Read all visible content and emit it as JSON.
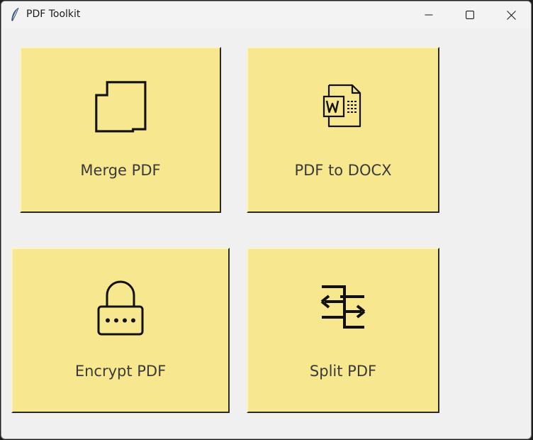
{
  "window": {
    "title": "PDF Toolkit",
    "controls": {
      "minimize": "minimize",
      "maximize": "maximize",
      "close": "close"
    }
  },
  "tiles": [
    {
      "label": "Merge PDF",
      "icon": "merge-icon"
    },
    {
      "label": "PDF to DOCX",
      "icon": "word-document-icon"
    },
    {
      "label": "Encrypt PDF",
      "icon": "lock-icon"
    },
    {
      "label": "Split PDF",
      "icon": "split-arrows-icon"
    }
  ],
  "colors": {
    "tile_background": "#f7e78f",
    "window_background": "#f0f0f0",
    "label_text": "#3a3a3a",
    "icon_stroke": "#111111"
  }
}
